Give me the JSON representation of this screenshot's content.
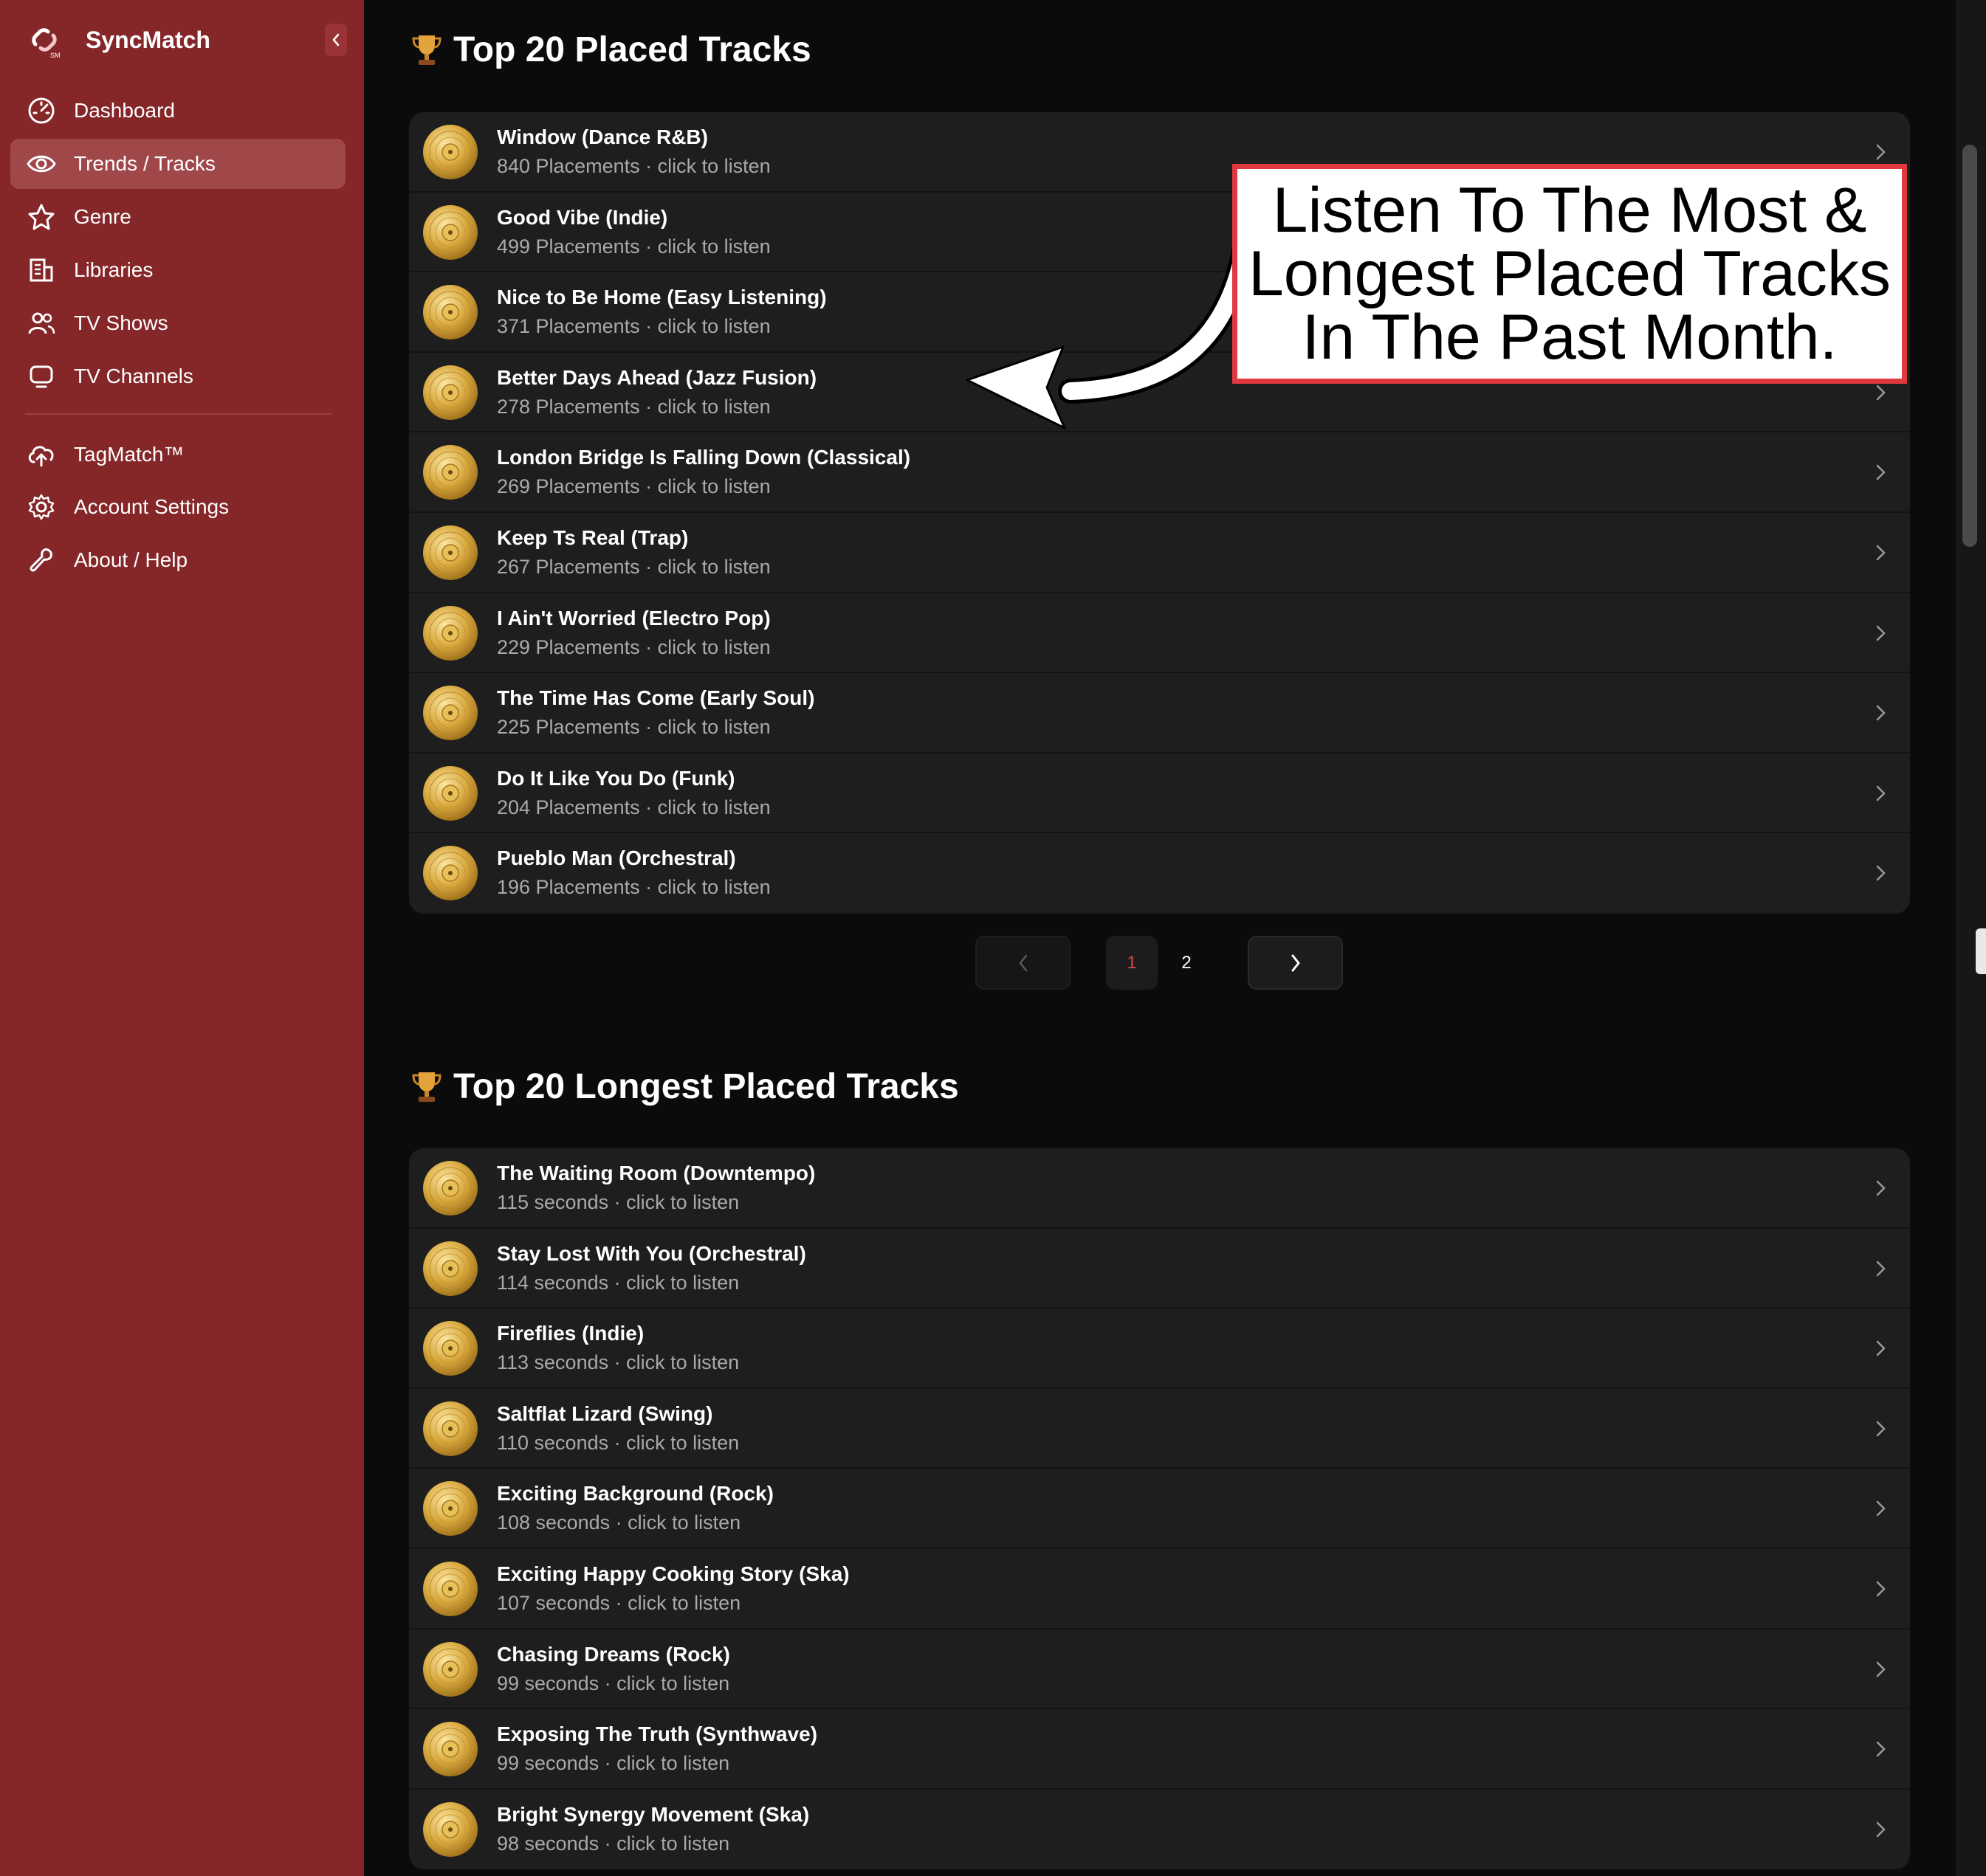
{
  "app": {
    "name": "SyncMatch",
    "logo_subtext": "SM"
  },
  "sidebar": {
    "items": [
      {
        "label": "Dashboard",
        "icon": "speedometer-icon",
        "active": false
      },
      {
        "label": "Trends / Tracks",
        "icon": "eye-icon",
        "active": true
      },
      {
        "label": "Genre",
        "icon": "star-icon",
        "active": false
      },
      {
        "label": "Libraries",
        "icon": "building-icon",
        "active": false
      },
      {
        "label": "TV Shows",
        "icon": "users-icon",
        "active": false
      },
      {
        "label": "TV Channels",
        "icon": "monitor-icon",
        "active": false
      }
    ],
    "secondary_items": [
      {
        "label": "TagMatch™",
        "icon": "cloud-upload-icon"
      },
      {
        "label": "Account Settings",
        "icon": "gear-icon"
      },
      {
        "label": "About / Help",
        "icon": "wrench-icon"
      }
    ]
  },
  "placed": {
    "title": "Top 20 Placed Tracks",
    "tracks": [
      {
        "title": "Window (Dance R&B)",
        "meta": "840 Placements · click to listen"
      },
      {
        "title": "Good Vibe (Indie)",
        "meta": "499 Placements · click to listen"
      },
      {
        "title": "Nice to Be Home (Easy Listening)",
        "meta": "371 Placements · click to listen"
      },
      {
        "title": "Better Days Ahead (Jazz Fusion)",
        "meta": "278 Placements · click to listen"
      },
      {
        "title": "London Bridge Is Falling Down (Classical)",
        "meta": "269 Placements · click to listen"
      },
      {
        "title": "Keep Ts Real (Trap)",
        "meta": "267 Placements · click to listen"
      },
      {
        "title": "I Ain't Worried (Electro Pop)",
        "meta": "229 Placements · click to listen"
      },
      {
        "title": "The Time Has Come (Early Soul)",
        "meta": "225 Placements · click to listen"
      },
      {
        "title": "Do It Like You Do (Funk)",
        "meta": "204 Placements · click to listen"
      },
      {
        "title": "Pueblo Man (Orchestral)",
        "meta": "196 Placements · click to listen"
      }
    ]
  },
  "pagination": {
    "pages": [
      "1",
      "2"
    ],
    "current": "1"
  },
  "longest": {
    "title": "Top 20 Longest Placed Tracks",
    "tracks": [
      {
        "title": "The Waiting Room (Downtempo)",
        "meta": "115 seconds · click to listen"
      },
      {
        "title": "Stay Lost With You (Orchestral)",
        "meta": "114 seconds · click to listen"
      },
      {
        "title": "Fireflies (Indie)",
        "meta": "113 seconds · click to listen"
      },
      {
        "title": "Saltflat Lizard (Swing)",
        "meta": "110 seconds · click to listen"
      },
      {
        "title": "Exciting Background (Rock)",
        "meta": "108 seconds · click to listen"
      },
      {
        "title": "Exciting Happy Cooking Story (Ska)",
        "meta": "107 seconds · click to listen"
      },
      {
        "title": "Chasing Dreams (Rock)",
        "meta": "99 seconds · click to listen"
      },
      {
        "title": "Exposing The Truth (Synthwave)",
        "meta": "99 seconds · click to listen"
      },
      {
        "title": "Bright Synergy Movement (Ska)",
        "meta": "98 seconds · click to listen"
      }
    ]
  },
  "annotation": {
    "lines": [
      "Listen To The Most &",
      "Longest Placed Tracks",
      "In The Past Month."
    ]
  },
  "colors": {
    "sidebar": "#852629",
    "sidebar_active": "#a0474a",
    "background": "#0b0b0b",
    "list_bg": "#1e1e1e",
    "accent": "#d0494b",
    "callout_border": "#e0393f"
  }
}
